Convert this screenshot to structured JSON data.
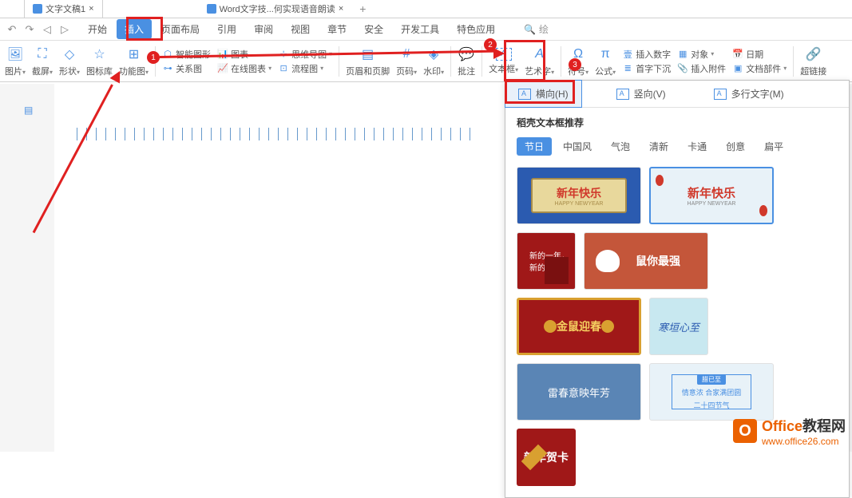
{
  "tabs": {
    "doc1": "文字文稿1",
    "doc2": "Word文字技...何实现语音朗读",
    "close": "×",
    "plus": "+"
  },
  "history": {
    "undo": "↶",
    "redo": "↷",
    "back": "◁",
    "fwd": "▷"
  },
  "menu": {
    "start": "开始",
    "insert": "插入",
    "layout": "页面布局",
    "ref": "引用",
    "review": "审阅",
    "view": "视图",
    "section": "章节",
    "safe": "安全",
    "dev": "开发工具",
    "special": "特色应用"
  },
  "search": {
    "icon": "🔍",
    "placeholder": "绘"
  },
  "ribbon": {
    "pic": "图片",
    "screenshot": "截屏",
    "shape": "形状",
    "iconlib": "图标库",
    "funcchart": "功能图",
    "smartgraph": "智能图形",
    "chart": "图表",
    "relation": "关系图",
    "onlinechart": "在线图表",
    "mindmap": "思维导图",
    "flowchart": "流程图",
    "header": "页眉和页脚",
    "pagenum": "页码",
    "watermark": "水印",
    "comment": "批注",
    "textbox": "文本框",
    "wordart": "艺术字",
    "symbol": "符号",
    "formula": "公式",
    "insertnum": "插入数字",
    "object": "对象",
    "date": "日期",
    "dropcap": "首字下沉",
    "attach": "插入附件",
    "docpart": "文档部件",
    "hyperlink": "超链接",
    "arrow": "▾"
  },
  "dropdown": {
    "horizontal": "横向(H)",
    "vertical": "竖向(V)",
    "multiline": "多行文字(M)",
    "section_title": "稻壳文本框推荐",
    "cats": {
      "holiday": "节日",
      "chinese": "中国风",
      "bubble": "气泡",
      "fresh": "清新",
      "cartoon": "卡通",
      "creative": "创意",
      "flat": "扁平"
    },
    "cards": {
      "c1a": "新年快乐",
      "c1b": "HAPPY NEWYEAR",
      "c2a": "新年快乐",
      "c2b": "HAPPY NEWYEAR",
      "c3a": "新的一年，",
      "c3b": "新的愿望。",
      "c4": "鼠你最强",
      "c5": "金鼠迎春",
      "c6": "寒垣心至",
      "c7": "雷春意映年芳",
      "c8t": "腊已至",
      "c8a": "情意浓 合家满团圆",
      "c8b": "二十四节气",
      "c9": "新年贺卡"
    }
  },
  "badges": {
    "b1": "1",
    "b2": "2",
    "b3": "3"
  },
  "watermark": {
    "brand1": "Office",
    "brand2": "教程网",
    "url": "www.office26.com",
    "icon": "O"
  }
}
